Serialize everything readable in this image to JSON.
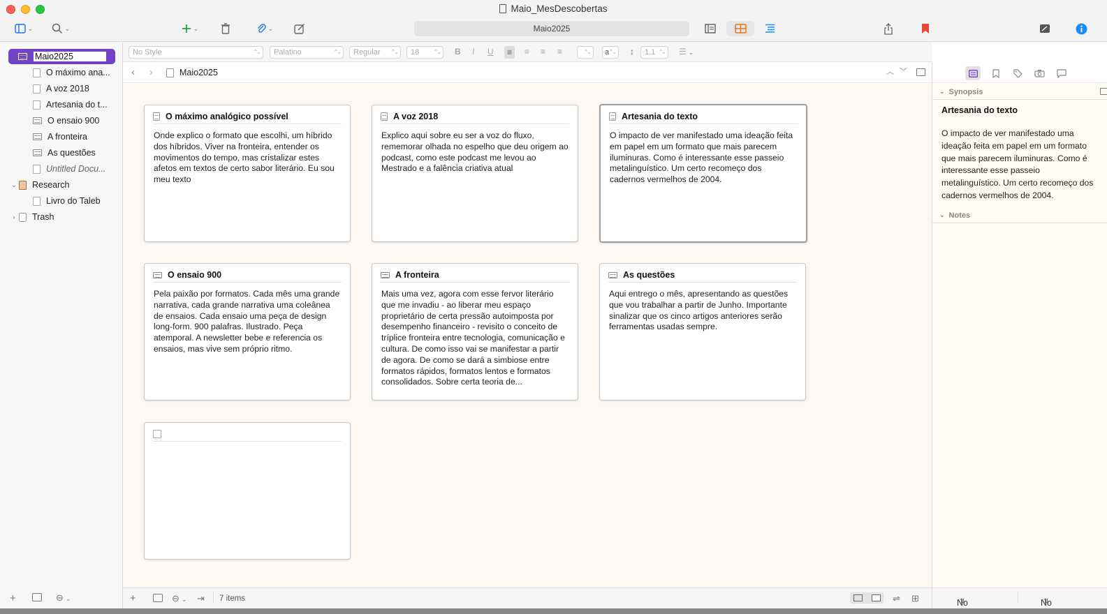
{
  "window": {
    "title": "Maio_MesDescobertas"
  },
  "toolbar": {
    "location": "Maio2025"
  },
  "format_bar": {
    "style": "No Style",
    "font": "Palatino",
    "weight": "Regular",
    "size": "18",
    "bold": "B",
    "italic": "I",
    "underline": "U",
    "highlight": "a",
    "line_spacing": "1.1"
  },
  "binder": {
    "root": {
      "label": "Maio2025"
    },
    "children": [
      {
        "label": "O máximo ana..."
      },
      {
        "label": "A voz 2018"
      },
      {
        "label": "Artesania do t..."
      },
      {
        "label": "O ensaio 900"
      },
      {
        "label": "A fronteira"
      },
      {
        "label": "As questões"
      },
      {
        "label": "Untitled Docu..."
      }
    ],
    "research": {
      "label": "Research",
      "children": [
        {
          "label": "Livro do Taleb"
        }
      ]
    },
    "trash": {
      "label": "Trash"
    }
  },
  "nav": {
    "title": "Maio2025"
  },
  "cards": [
    {
      "title": "O máximo analógico possível",
      "body": "Onde explico o formato que escolhi, um híbrido dos híbridos. Viver na fronteira, entender os movimentos do tempo, mas cristalizar estes afetos em textos de certo sabor literário. Eu sou meu texto"
    },
    {
      "title": "A voz 2018",
      "body": "Explico aqui sobre eu ser a voz do fluxo, rememorar olhada no espelho que deu origem ao podcast, como este podcast me levou ao Mestrado e a falência criativa atual"
    },
    {
      "title": "Artesania do texto",
      "body": "O impacto de ver manifestado uma ideação feita em papel em um formato que mais parecem iluminuras. Como é interessante esse passeio metalinguístico. Um certo recomeço dos cadernos vermelhos de 2004."
    },
    {
      "title": "O ensaio 900",
      "body": "Pela paixão por formatos. Cada mês uma grande narrativa, cada grande narrativa uma coleânea de ensaios. Cada ensaio uma peça de design long-form. 900 palafras. Ilustrado. Peça atemporal. A newsletter bebe e referencia os ensaios, mas vive sem próprio ritmo."
    },
    {
      "title": "A fronteira",
      "body": "Mais uma vez, agora com esse fervor literário que me invadiu - ao liberar meu espaço proprietário de certa pressão autoimposta por desempenho financeiro - revisito o conceito de tríplice fronteira entre tecnologia, comunicação e cultura. De como isso vai se manifestar a partir de agora. De como se dará a simbiose entre formatos rápidos, formatos lentos e formatos consolidados. Sobre certa teoria de..."
    },
    {
      "title": "As questões",
      "body": "Aqui entrego o mês, apresentando as questões que vou trabalhar a partir de Junho. Importante sinalizar que os cinco artigos anteriores serão ferramentas usadas sempre."
    },
    {
      "title": "",
      "body": ""
    }
  ],
  "footer": {
    "items_count": "7 items"
  },
  "inspector": {
    "synopsis_label": "Synopsis",
    "synopsis_title": "Artesania do texto",
    "synopsis_text": "O impacto de ver manifestado uma ideação feita em papel em um formato que mais parecem iluminuras. Como é interessante esse passeio metalinguístico. Um certo recomeço dos cadernos vermelhos de 2004.",
    "notes_label": "Notes",
    "label_value": "No Label",
    "status_value": "No Status"
  },
  "colors": {
    "selection": "#7243c7",
    "corkboard_bg": "#fdf8f3",
    "inspector_bg": "#fffcf4",
    "bookmark": "#e8453c",
    "info": "#1a8cff"
  }
}
